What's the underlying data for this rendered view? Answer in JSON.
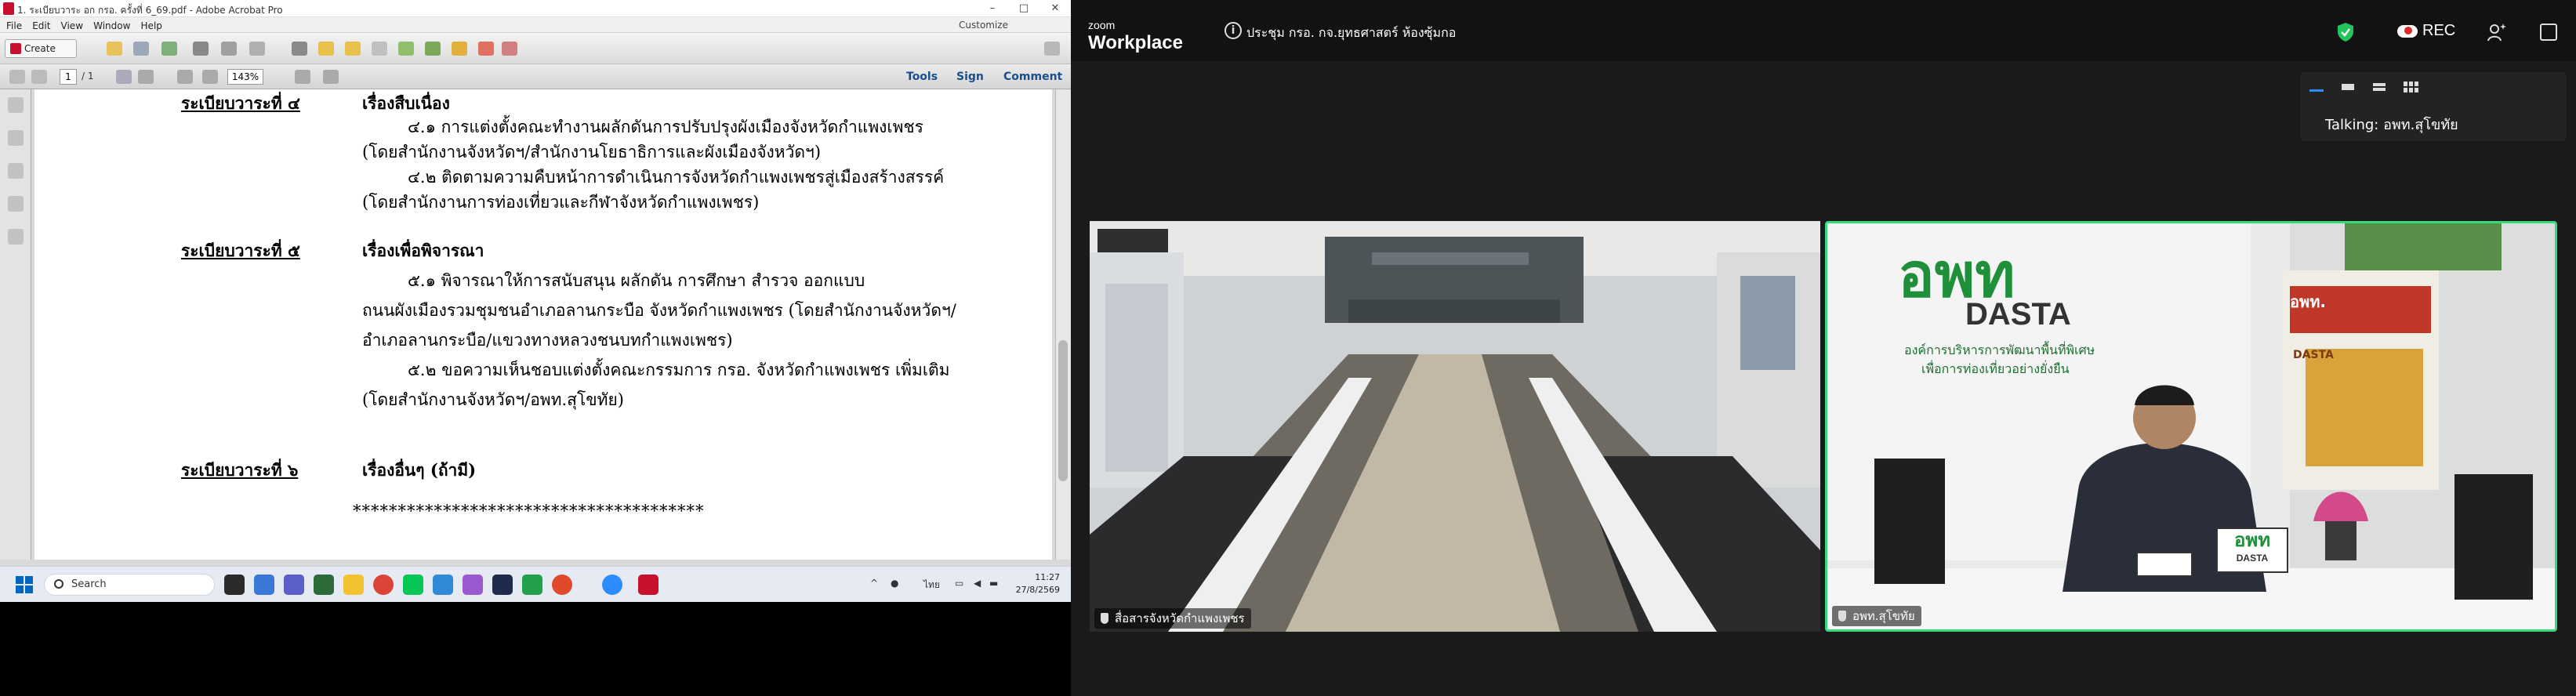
{
  "acrobat": {
    "title": "1. ระเบียบวาระ อก กรอ. ครั้งที่ 6_69.pdf - Adobe Acrobat Pro",
    "menu": [
      "File",
      "Edit",
      "View",
      "Window",
      "Help"
    ],
    "customize": "Customize",
    "create_label": "Create",
    "page_current": "1",
    "page_total": "/ 1",
    "zoom": "143%",
    "right_links": {
      "tools": "Tools",
      "sign": "Sign",
      "comment": "Comment"
    }
  },
  "document": {
    "agenda4": {
      "heading": "ระเบียบวาระที่ ๔",
      "subject": "เรื่องสืบเนื่อง",
      "lines": [
        "๔.๑ การแต่งตั้งคณะทำงานผลักดันการปรับปรุงผังเมืองจังหวัดกำแพงเพชร",
        "(โดยสำนักงานจังหวัดฯ/สำนักงานโยธาธิการและผังเมืองจังหวัดฯ)",
        "๔.๒ ติดตามความคืบหน้าการดำเนินการจังหวัดกำแพงเพชรสู่เมืองสร้างสรรค์",
        "(โดยสำนักงานการท่องเที่ยวและกีฬาจังหวัดกำแพงเพชร)"
      ]
    },
    "agenda5": {
      "heading": "ระเบียบวาระที่ ๕",
      "subject": "เรื่องเพื่อพิจารณา",
      "lines": [
        "๕.๑ พิจารณาให้การสนับสนุน ผลักดัน การศึกษา สำรวจ ออกแบบ",
        "ถนนผังเมืองรวมชุมชนอำเภอลานกระบือ จังหวัดกำแพงเพชร (โดยสำนักงานจังหวัดฯ/",
        "อำเภอลานกระบือ/แขวงทางหลวงชนบทกำแพงเพชร)",
        "๕.๒ ขอความเห็นชอบแต่งตั้งคณะกรรมการ กรอ. จังหวัดกำแพงเพชร เพิ่มเติม",
        "(โดยสำนักงานจังหวัดฯ/อพท.สุโขทัย)"
      ]
    },
    "agenda6": {
      "heading": "ระเบียบวาระที่ ๖",
      "subject": "เรื่องอื่นๆ  (ถ้ามี)"
    },
    "stars": "***************************************"
  },
  "taskbar": {
    "search_placeholder": "Search",
    "lang": "ไทย",
    "time": "11:27",
    "date": "27/8/2569"
  },
  "zoom": {
    "logo_top": "zoom",
    "logo_bottom": "Workplace",
    "meeting_title": "ประชุม กรอ. กจ.ยุทธศาสตร์ ห้องซุ้มกอ",
    "rec_label": "REC",
    "talking": "Talking: อพท.สุโขทัย",
    "tiles": [
      {
        "name": "สื่อสารจังหวัดกำแพงเพชร"
      },
      {
        "name": "อพท.สุโขทัย",
        "sign_big": "อพท",
        "sign_mid": "DASTA",
        "sign_sub1": "องค์การบริหารการพัฒนาพื้นที่พิเศษ",
        "sign_sub2": "เพื่อการท่องเที่ยวอย่างยั่งยืน",
        "poster_top": "อพท.",
        "poster_mid": "DASTA",
        "table_sign": "อพท",
        "table_sign2": "DASTA"
      }
    ]
  },
  "colors": {
    "accent_green": "#37d97a",
    "acrobat_red": "#c8102e",
    "zoom_bg": "#1a1a1a"
  }
}
